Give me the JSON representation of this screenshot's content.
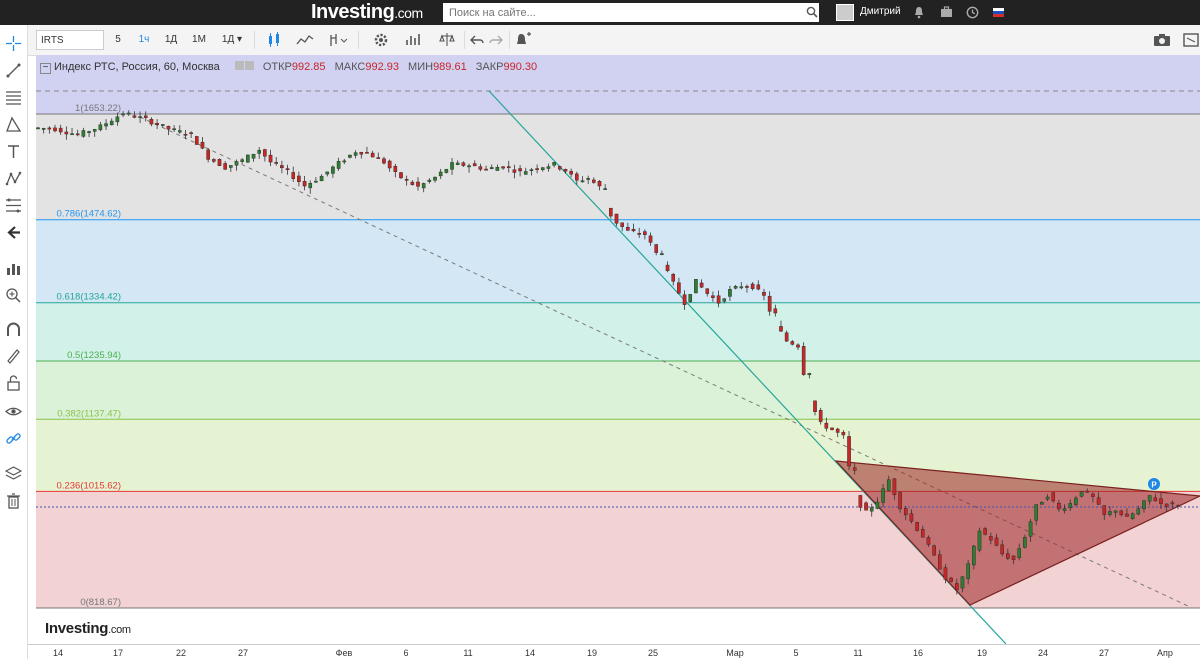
{
  "site": {
    "logo_text": "Investing",
    "logo_suffix": ".com",
    "search_placeholder": "Поиск на сайте...",
    "username": "Дмитрий"
  },
  "toolbar": {
    "symbol": "IRTS",
    "intervals": [
      {
        "label": "5",
        "active": false
      },
      {
        "label": "1ч",
        "active": true
      },
      {
        "label": "1Д",
        "active": false
      },
      {
        "label": "1М",
        "active": false
      },
      {
        "label": "1Д",
        "active": false
      }
    ]
  },
  "legend": {
    "title": "Индекс РТС, Россия, 60, Москва",
    "open_label": "ОТКР",
    "open": "992.85",
    "high_label": "МАКС",
    "high": "992.93",
    "low_label": "МИН",
    "low": "989.61",
    "close_label": "ЗАКР",
    "close": "990.30"
  },
  "fib_levels": [
    {
      "ratio": "1",
      "price": 1653.22,
      "label": "1(1653.22)",
      "color": "#777777"
    },
    {
      "ratio": "0.786",
      "price": 1474.62,
      "label": "0.786(1474.62)",
      "color": "#2196f3"
    },
    {
      "ratio": "0.618",
      "price": 1334.42,
      "label": "0.618(1334.42)",
      "color": "#26a69a"
    },
    {
      "ratio": "0.5",
      "price": 1235.94,
      "label": "0.5(1235.94)",
      "color": "#4caf50"
    },
    {
      "ratio": "0.382",
      "price": 1137.47,
      "label": "0.382(1137.47)",
      "color": "#8bc34a"
    },
    {
      "ratio": "0.236",
      "price": 1015.62,
      "label": "0.236(1015.62)",
      "color": "#e53935"
    },
    {
      "ratio": "0",
      "price": 818.67,
      "label": "0(818.67)",
      "color": "#777777"
    }
  ],
  "x_axis_labels": [
    "14",
    "17",
    "22",
    "27",
    "Фев",
    "6",
    "11",
    "14",
    "19",
    "25",
    "Мар",
    "5",
    "11",
    "16",
    "19",
    "24",
    "27",
    "Апр"
  ],
  "watermark": {
    "text": "Investing",
    "suffix": ".com"
  },
  "marker_label": "P",
  "chart_data": {
    "type": "candlestick",
    "title": "Индекс РТС, Россия, 60, Москва",
    "x_ticks": [
      "14",
      "17",
      "22",
      "27",
      "Фев",
      "6",
      "11",
      "14",
      "19",
      "25",
      "Мар",
      "5",
      "11",
      "16",
      "19",
      "24",
      "27",
      "Апр"
    ],
    "ylim": [
      818.67,
      1653.22
    ],
    "price_path": [
      [
        0,
        1630
      ],
      [
        4,
        1628
      ],
      [
        8,
        1618
      ],
      [
        12,
        1632
      ],
      [
        16,
        1655
      ],
      [
        20,
        1644
      ],
      [
        24,
        1628
      ],
      [
        28,
        1618
      ],
      [
        31,
        1580
      ],
      [
        34,
        1563
      ],
      [
        37,
        1575
      ],
      [
        40,
        1593
      ],
      [
        42,
        1572
      ],
      [
        45,
        1555
      ],
      [
        48,
        1532
      ],
      [
        51,
        1548
      ],
      [
        54,
        1570
      ],
      [
        57,
        1590
      ],
      [
        59,
        1588
      ],
      [
        62,
        1572
      ],
      [
        64,
        1552
      ],
      [
        66,
        1540
      ],
      [
        68,
        1530
      ],
      [
        71,
        1546
      ],
      [
        74,
        1568
      ],
      [
        77,
        1567
      ],
      [
        80,
        1560
      ],
      [
        83,
        1565
      ],
      [
        86,
        1555
      ],
      [
        89,
        1563
      ],
      [
        92,
        1568
      ],
      [
        94,
        1558
      ],
      [
        96,
        1540
      ],
      [
        98,
        1545
      ],
      [
        100,
        1530
      ],
      [
        101,
        1495
      ],
      [
        103,
        1470
      ],
      [
        105,
        1455
      ],
      [
        108,
        1450
      ],
      [
        111,
        1402
      ],
      [
        113,
        1367
      ],
      [
        115,
        1335
      ],
      [
        117,
        1370
      ],
      [
        119,
        1350
      ],
      [
        121,
        1335
      ],
      [
        123,
        1355
      ],
      [
        125,
        1363
      ],
      [
        127,
        1362
      ],
      [
        129,
        1345
      ],
      [
        131,
        1298
      ],
      [
        133,
        1270
      ],
      [
        135,
        1262
      ],
      [
        137,
        1170
      ],
      [
        139,
        1130
      ],
      [
        141,
        1120
      ],
      [
        143,
        1108
      ],
      [
        145,
        1005
      ],
      [
        147,
        980
      ],
      [
        149,
        1000
      ],
      [
        151,
        1035
      ],
      [
        153,
        990
      ],
      [
        155,
        965
      ],
      [
        157,
        940
      ],
      [
        159,
        905
      ],
      [
        161,
        870
      ],
      [
        163,
        850
      ],
      [
        165,
        890
      ],
      [
        167,
        950
      ],
      [
        169,
        935
      ],
      [
        171,
        910
      ],
      [
        173,
        900
      ],
      [
        175,
        940
      ],
      [
        177,
        990
      ],
      [
        179,
        1010
      ],
      [
        181,
        985
      ],
      [
        183,
        995
      ],
      [
        185,
        1018
      ],
      [
        187,
        1005
      ],
      [
        189,
        975
      ],
      [
        191,
        985
      ],
      [
        193,
        970
      ],
      [
        195,
        985
      ],
      [
        197,
        1008
      ],
      [
        199,
        995
      ],
      [
        201,
        992
      ]
    ],
    "n_bars": 202
  }
}
